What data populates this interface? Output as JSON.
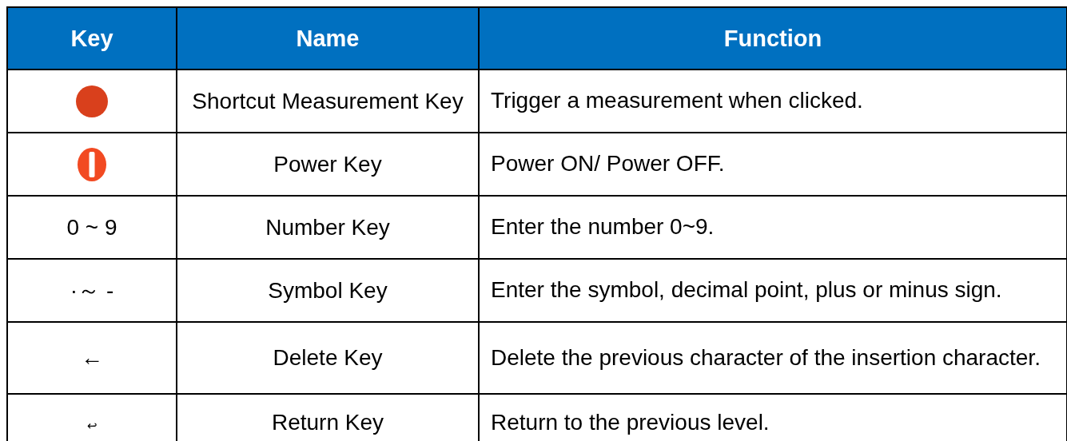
{
  "table": {
    "columns": [
      "Key",
      "Name",
      "Function"
    ],
    "rows": [
      {
        "key": {
          "kind": "dot-icon"
        },
        "name": "Shortcut Measurement Key",
        "function": "Trigger a measurement when clicked."
      },
      {
        "key": {
          "kind": "power-icon"
        },
        "name": "Power Key",
        "function": "Power ON/ Power OFF."
      },
      {
        "key": {
          "kind": "text",
          "text": "0 ~ 9"
        },
        "name": "Number Key",
        "function": "Enter the number 0~9."
      },
      {
        "key": {
          "kind": "text",
          "text": "·～ -"
        },
        "name": "Symbol Key",
        "function": "Enter the symbol, decimal point, plus or minus sign."
      },
      {
        "key": {
          "kind": "text",
          "text": "←"
        },
        "name": "Delete Key",
        "function": "Delete the previous character of the insertion character."
      },
      {
        "key": {
          "kind": "small",
          "text": "↩"
        },
        "name": "Return Key",
        "function": "Return to the previous level."
      }
    ]
  }
}
